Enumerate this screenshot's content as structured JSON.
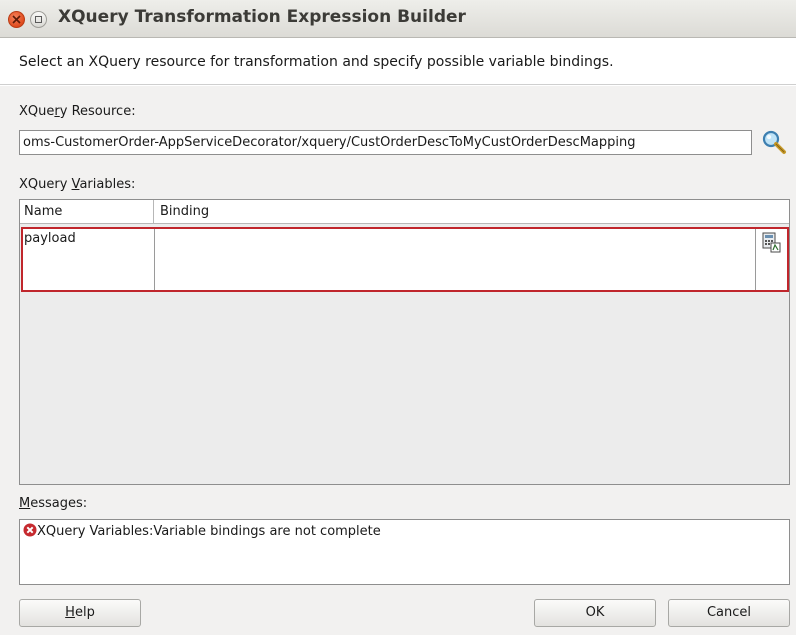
{
  "window": {
    "title": "XQuery Transformation Expression Builder",
    "close_icon": "close-icon",
    "maximize_icon": "maximize-icon"
  },
  "header": {
    "description": "Select an XQuery resource for transformation and specify possible variable bindings."
  },
  "resource": {
    "label_pre": "XQue",
    "label_mnemonic": "r",
    "label_post": "y Resource:",
    "value": "oms-CustomerOrder-AppServiceDecorator/xquery/CustOrderDescToMyCustOrderDescMapping",
    "browse_icon": "search-icon"
  },
  "variables": {
    "label_pre": "XQuery ",
    "label_mnemonic": "V",
    "label_post": "ariables:",
    "columns": [
      "Name",
      "Binding"
    ],
    "rows": [
      {
        "name": "payload",
        "binding": ""
      }
    ],
    "edit_icon": "expression-builder-icon"
  },
  "messages": {
    "label_mnemonic": "M",
    "label_post": "essages:",
    "items": [
      {
        "icon": "error-icon",
        "text": "XQuery Variables:Variable bindings are not complete"
      }
    ]
  },
  "buttons": {
    "help_mnemonic": "H",
    "help_post": "elp",
    "ok": "OK",
    "cancel": "Cancel"
  },
  "colors": {
    "error_red": "#c0262c",
    "titlebar_close": "#df4b1e"
  }
}
